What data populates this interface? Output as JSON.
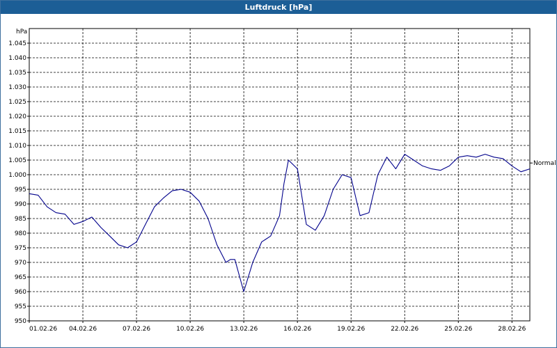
{
  "window": {
    "title": "Luftdruck [hPa]"
  },
  "chart_data": {
    "type": "line",
    "title": "Luftdruck [hPa]",
    "ylabel": "hPa",
    "xlabel": "",
    "ylim": [
      950,
      1050
    ],
    "y_ticks": [
      950,
      955,
      960,
      965,
      970,
      975,
      980,
      985,
      990,
      995,
      1000,
      1005,
      1010,
      1015,
      1020,
      1025,
      1030,
      1035,
      1040,
      1045
    ],
    "y_tick_labels": [
      "950",
      "955",
      "960",
      "965",
      "970",
      "975",
      "980",
      "985",
      "990",
      "995",
      "1.000",
      "1.005",
      "1.010",
      "1.015",
      "1.020",
      "1.025",
      "1.030",
      "1.035",
      "1.040",
      "1.045"
    ],
    "xlim": [
      "01.02.26",
      "01.03.26"
    ],
    "x_ticks": [
      "01.02.26",
      "04.02.26",
      "07.02.26",
      "10.02.26",
      "13.02.26",
      "16.02.26",
      "19.02.26",
      "22.02.26",
      "25.02.26",
      "28.02.26"
    ],
    "grid": true,
    "reference_line": {
      "label": "Normal",
      "value": 1004
    },
    "series": [
      {
        "color": "#00008b",
        "x": [
          "01.02.26 00:00",
          "01.02.26 12:00",
          "02.02.26 00:00",
          "02.02.26 12:00",
          "03.02.26 00:00",
          "03.02.26 12:00",
          "04.02.26 00:00",
          "04.02.26 12:00",
          "05.02.26 00:00",
          "05.02.26 12:00",
          "06.02.26 00:00",
          "06.02.26 12:00",
          "07.02.26 00:00",
          "07.02.26 12:00",
          "08.02.26 00:00",
          "08.02.26 12:00",
          "09.02.26 00:00",
          "09.02.26 12:00",
          "10.02.26 00:00",
          "10.02.26 12:00",
          "11.02.26 00:00",
          "11.02.26 12:00",
          "12.02.26 00:00",
          "12.02.26 06:00",
          "12.02.26 12:00",
          "13.02.26 00:00",
          "13.02.26 12:00",
          "14.02.26 00:00",
          "14.02.26 12:00",
          "15.02.26 00:00",
          "15.02.26 06:00",
          "15.02.26 12:00",
          "16.02.26 00:00",
          "16.02.26 12:00",
          "17.02.26 00:00",
          "17.02.26 12:00",
          "18.02.26 00:00",
          "18.02.26 12:00",
          "19.02.26 00:00",
          "19.02.26 12:00",
          "20.02.26 00:00",
          "20.02.26 12:00",
          "21.02.26 00:00",
          "21.02.26 12:00",
          "22.02.26 00:00",
          "22.02.26 12:00",
          "23.02.26 00:00",
          "23.02.26 12:00",
          "24.02.26 00:00",
          "24.02.26 12:00",
          "25.02.26 00:00",
          "25.02.26 12:00",
          "26.02.26 00:00",
          "26.02.26 12:00",
          "27.02.26 00:00",
          "27.02.26 12:00",
          "28.02.26 00:00",
          "28.02.26 12:00",
          "01.03.26 00:00"
        ],
        "y": [
          993.5,
          993,
          989,
          987,
          986.5,
          983,
          984,
          985.5,
          982,
          979,
          976,
          975,
          977,
          983,
          989,
          992,
          994.5,
          995,
          994,
          991,
          985,
          976,
          970,
          971,
          971,
          960,
          970,
          977,
          979,
          986,
          997,
          1005,
          1002,
          983,
          981,
          986,
          995,
          1000,
          999,
          986,
          987,
          1000,
          1006,
          1002,
          1007,
          1005,
          1003,
          1002,
          1001.5,
          1003,
          1006,
          1006.5,
          1006,
          1007,
          1006,
          1005.5,
          1003,
          1001,
          1002
        ]
      }
    ]
  }
}
